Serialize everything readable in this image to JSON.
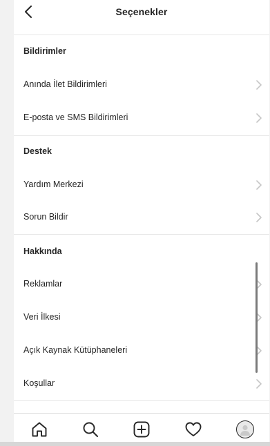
{
  "header": {
    "title": "Seçenekler"
  },
  "sections": [
    {
      "heading": "Bildirimler",
      "items": [
        {
          "label": "Anında İlet Bildirimleri"
        },
        {
          "label": "E-posta ve SMS Bildirimleri"
        }
      ]
    },
    {
      "heading": "Destek",
      "items": [
        {
          "label": "Yardım Merkezi"
        },
        {
          "label": "Sorun Bildir"
        }
      ]
    },
    {
      "heading": "Hakkında",
      "items": [
        {
          "label": "Reklamlar"
        },
        {
          "label": "Veri İlkesi"
        },
        {
          "label": "Açık Kaynak Kütüphaneleri"
        },
        {
          "label": "Koşullar"
        }
      ]
    }
  ],
  "tabbar": {
    "icons": [
      "home-icon",
      "search-icon",
      "add-post-icon",
      "heart-icon",
      "profile-avatar"
    ]
  },
  "colors": {
    "text": "#262626",
    "chevron": "#c7c7c7",
    "divider": "#e8e8e8"
  }
}
